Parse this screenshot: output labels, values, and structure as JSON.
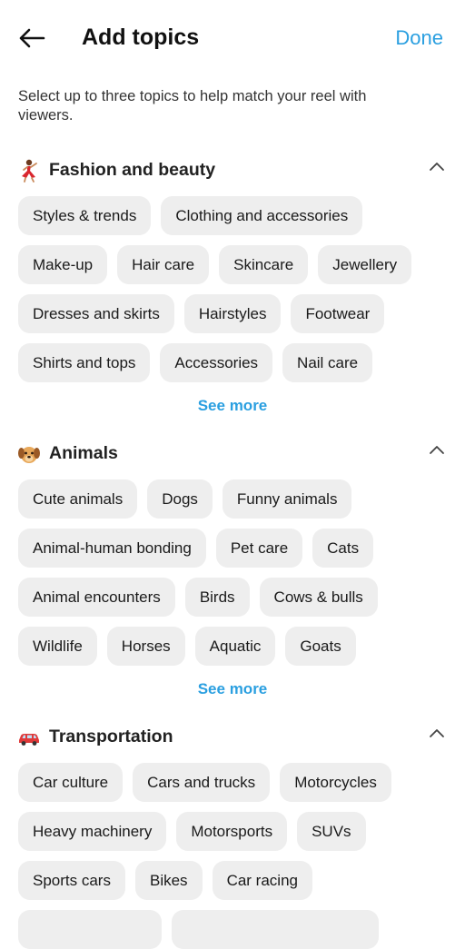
{
  "header": {
    "title": "Add topics",
    "done_label": "Done"
  },
  "intro": "Select up to three topics to help match your reel with viewers.",
  "sections": [
    {
      "emoji": "dancer-emoji",
      "title": "Fashion and beauty",
      "chips": [
        "Styles & trends",
        "Clothing and accessories",
        "Make-up",
        "Hair care",
        "Skincare",
        "Jewellery",
        "Dresses and skirts",
        "Hairstyles",
        "Footwear",
        "Shirts and tops",
        "Accessories",
        "Nail care"
      ],
      "see_more": "See more"
    },
    {
      "emoji": "dog-face-emoji",
      "title": "Animals",
      "chips": [
        "Cute animals",
        "Dogs",
        "Funny animals",
        "Animal-human bonding",
        "Pet care",
        "Cats",
        "Animal encounters",
        "Birds",
        "Cows & bulls",
        "Wildlife",
        "Horses",
        "Aquatic",
        "Goats"
      ],
      "see_more": "See more"
    },
    {
      "emoji": "car-emoji",
      "title": "Transportation",
      "chips": [
        "Car culture",
        "Cars and trucks",
        "Motorcycles",
        "Heavy machinery",
        "Motorsports",
        "SUVs",
        "Sports cars",
        "Bikes",
        "Car racing"
      ]
    }
  ]
}
